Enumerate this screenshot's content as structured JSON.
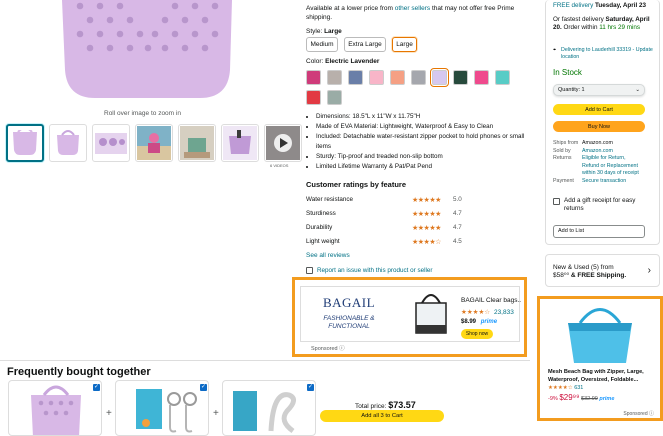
{
  "gallery": {
    "rollover_text": "Roll over image to zoom in",
    "thumb_caption": "6 VIDEOS"
  },
  "offer": {
    "lower_price_text_1": "Available at a lower price from",
    "lower_price_link": "other sellers",
    "lower_price_text_2": "that may not offer free Prime shipping."
  },
  "style": {
    "label": "Style:",
    "value": "Large",
    "options": [
      "Medium",
      "Extra Large",
      "Large"
    ],
    "selected_index": 2
  },
  "color": {
    "label": "Color:",
    "value": "Electric Lavender",
    "swatches": [
      "#cf3b7a",
      "#b8b0ab",
      "#6a7fa8",
      "#f8b5c8",
      "#f5a084",
      "#a5a7ad",
      "#d6c8ef",
      "#274a3c",
      "#ef4a8d",
      "#58ccc6",
      "#e23a43",
      "#9aaca6"
    ],
    "selected_index": 6
  },
  "bullets": [
    "Dimensions: 18.5\"L x 11\"W x 11.75\"H",
    "Made of EVA Material: Lightweight, Waterproof & Easy to Clean",
    "Included: Detachable water-resistant zipper pocket to hold phones or small items",
    "Sturdy: Tip-proof and treaded non-slip bottom",
    "Limited Lifetime Warranty & Pat/Pat Pend"
  ],
  "ratings": {
    "title": "Customer ratings by feature",
    "rows": [
      {
        "label": "Water resistance",
        "value": "5.0",
        "stars": "★★★★★"
      },
      {
        "label": "Sturdiness",
        "value": "4.7",
        "stars": "★★★★★"
      },
      {
        "label": "Durability",
        "value": "4.7",
        "stars": "★★★★★"
      },
      {
        "label": "Light weight",
        "value": "4.5",
        "stars": "★★★★☆"
      }
    ],
    "see_all": "See all reviews",
    "report": "Report an issue with this product or seller"
  },
  "center_ad": {
    "brand": "BAGAIL",
    "tagline": "FASHIONABLE & FUNCTIONAL",
    "product_title": "BAGAIL Clear bags...",
    "stars": "★★★★☆",
    "review_count": "23,833",
    "price": "$8.99",
    "prime": "prime",
    "shop_label": "Shop now",
    "sponsored": "Sponsored ⓘ"
  },
  "buybox": {
    "free_delivery_label": "FREE delivery",
    "free_delivery_date": "Tuesday, April 23",
    "fastest_1": "Or fastest delivery",
    "fastest_date": "Saturday, April 20.",
    "order_within": "Order within",
    "countdown": "11 hrs 29 mins",
    "deliver_to": "Delivering to Lauderhill 33319 - Update location",
    "stock": "In Stock",
    "quantity": "Quantity: 1",
    "add_to_cart": "Add to Cart",
    "buy_now": "Buy Now",
    "ships_from_k": "Ships from",
    "ships_from_v": "Amazon.com",
    "sold_by_k": "Sold by",
    "sold_by_v": "Amazon.com",
    "returns_k": "Returns",
    "returns_v": "Eligible for Return, Refund or Replacement within 30 days of receipt",
    "payment_k": "Payment",
    "payment_v": "Secure transaction",
    "gift": "Add a gift receipt for easy returns",
    "add_list": "Add to List"
  },
  "new_used": {
    "text": "New & Used (5) from",
    "price": "$58⁰⁰",
    "shipping": "& FREE Shipping."
  },
  "right_ad": {
    "title": "Mesh Beach Bag with Zipper, Large, Waterproof, Oversized, Foldable...",
    "stars": "★★★★☆",
    "count": "631",
    "discount": "-9%",
    "price": "$29⁹⁹",
    "list_price": "$32.99",
    "prime": "prime",
    "sponsored": "Sponsored ⓘ"
  },
  "fbt": {
    "title": "Frequently bought together",
    "total_label": "Total price:",
    "total_value": "$73.57",
    "add_all": "Add all 3 to Cart"
  }
}
